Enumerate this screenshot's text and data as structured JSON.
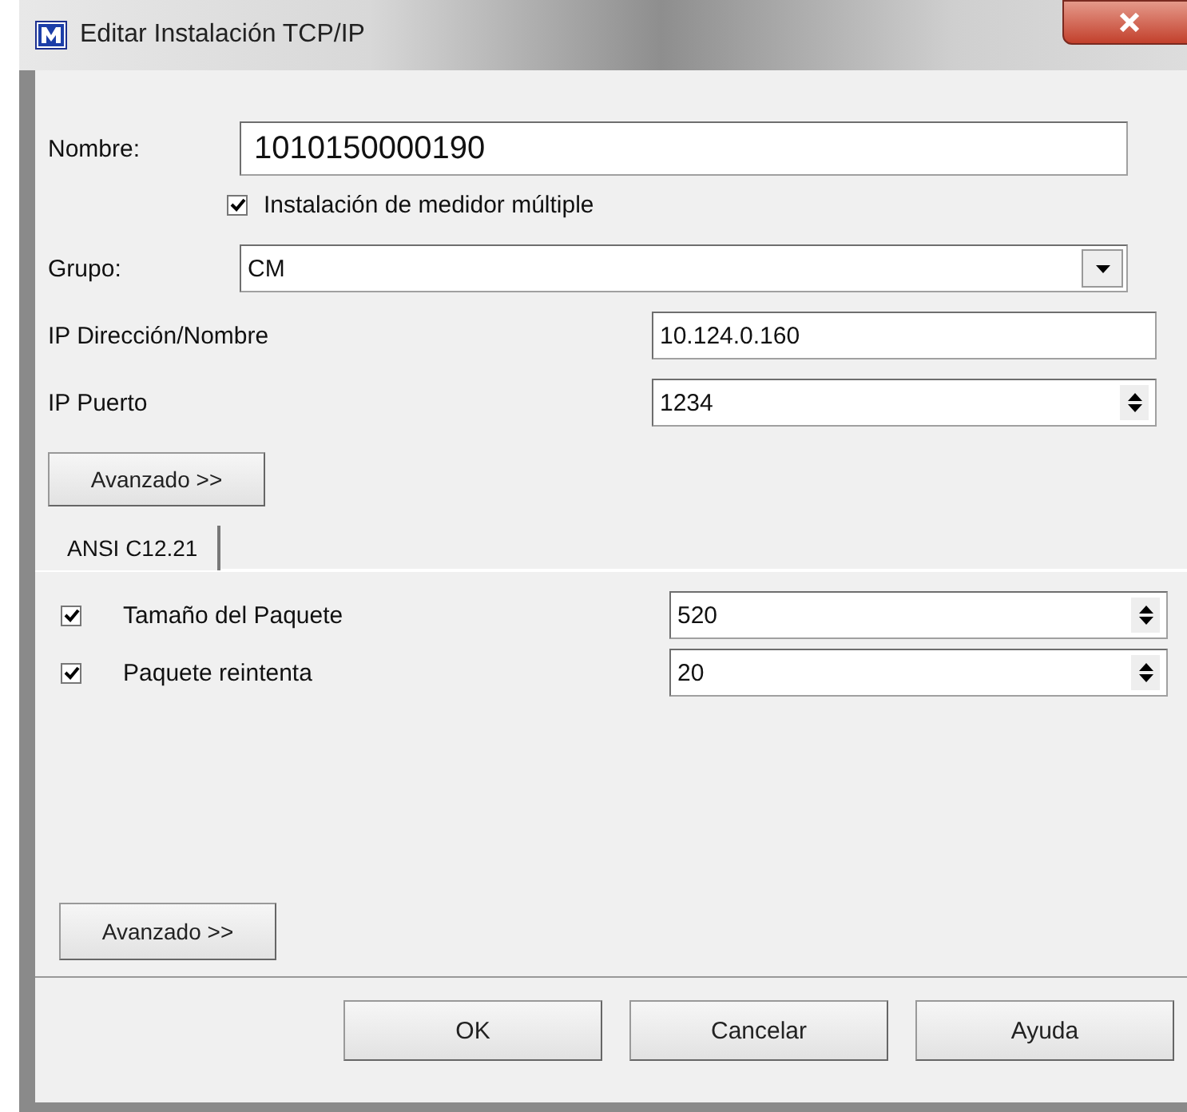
{
  "window": {
    "title": "Editar Instalación TCP/IP"
  },
  "nombre": {
    "label": "Nombre:",
    "value": "1010150000190"
  },
  "multiple": {
    "label": "Instalación de medidor múltiple",
    "checked": true
  },
  "grupo": {
    "label": "Grupo:",
    "value": "CM"
  },
  "ip_fields": [
    {
      "label": "IP Dirección/Nombre",
      "value": "10.124.0.160",
      "kind": "text"
    },
    {
      "label": "IP Puerto",
      "value": "1234",
      "kind": "spin"
    }
  ],
  "advanced_top": "Avanzado >>",
  "tabs": [
    {
      "label": "ANSI C12.21",
      "selected": true
    }
  ],
  "settings": [
    {
      "label": "Tamaño del Paquete",
      "checked": true,
      "value": "520"
    },
    {
      "label": "Paquete reintenta",
      "checked": true,
      "value": "20"
    }
  ],
  "advanced_bottom": "Avanzado >>",
  "buttons": [
    "OK",
    "Cancelar",
    "Ayuda"
  ]
}
